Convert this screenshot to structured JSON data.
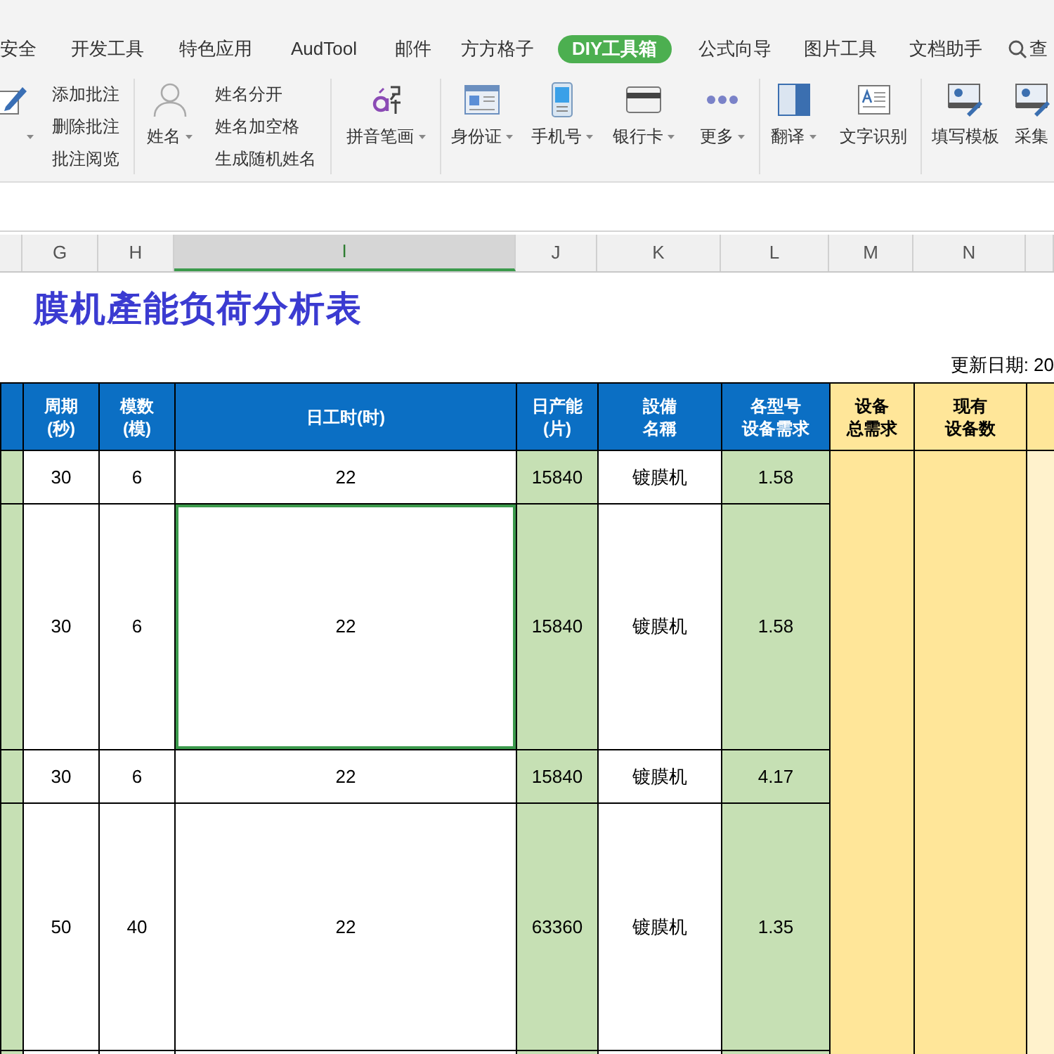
{
  "tabs": [
    {
      "label": "安全",
      "selected": false
    },
    {
      "label": "开发工具",
      "selected": false
    },
    {
      "label": "特色应用",
      "selected": false
    },
    {
      "label": "AudTool",
      "selected": false
    },
    {
      "label": "邮件",
      "selected": false
    },
    {
      "label": "方方格子",
      "selected": false
    },
    {
      "label": "DIY工具箱",
      "selected": true
    },
    {
      "label": "公式向导",
      "selected": false
    },
    {
      "label": "图片工具",
      "selected": false
    },
    {
      "label": "文档助手",
      "selected": false
    }
  ],
  "search": {
    "label": "查"
  },
  "ribbon": [
    {
      "kind": "large",
      "dropdown": true
    },
    {
      "kind": "small",
      "items": [
        "添加批注",
        "删除批注",
        "批注阅览"
      ]
    },
    {
      "kind": "separator"
    },
    {
      "kind": "large",
      "label": "姓名",
      "dropdown": true
    },
    {
      "kind": "small",
      "items": [
        "姓名分开",
        "姓名加空格",
        "生成随机姓名"
      ]
    },
    {
      "kind": "separator"
    },
    {
      "kind": "large",
      "label": "拼音笔画",
      "dropdown": true
    },
    {
      "kind": "separator"
    },
    {
      "kind": "large",
      "label": "身份证",
      "dropdown": true
    },
    {
      "kind": "large",
      "label": "手机号",
      "dropdown": true
    },
    {
      "kind": "large",
      "label": "银行卡",
      "dropdown": true
    },
    {
      "kind": "large",
      "label": "更多",
      "dropdown": true
    },
    {
      "kind": "separator"
    },
    {
      "kind": "large",
      "label": "翻译",
      "dropdown": true
    },
    {
      "kind": "large",
      "label": "文字识别",
      "dropdown": false
    },
    {
      "kind": "separator"
    },
    {
      "kind": "large",
      "label": "填写模板",
      "dropdown": false
    },
    {
      "kind": "large",
      "label": "采集",
      "dropdown": false
    }
  ],
  "column_headers": [
    {
      "selected": false
    },
    {
      "label": "G",
      "selected": false
    },
    {
      "label": "H",
      "selected": false
    },
    {
      "label": "I",
      "selected": true
    },
    {
      "label": "J",
      "selected": false
    },
    {
      "label": "K",
      "selected": false
    },
    {
      "label": "L",
      "selected": false
    },
    {
      "label": "M",
      "selected": false
    },
    {
      "label": "N",
      "selected": false
    },
    {
      "selected": false
    }
  ],
  "title": "膜机產能负荷分析表",
  "update_date": "更新日期: 20",
  "table": {
    "columns": [
      "周期(秒)",
      "模数(模)",
      "日工时(时)",
      "日产能(片)",
      "設備名稱",
      "各型号设备需求",
      "设备总需求",
      "现有设备数"
    ],
    "rows": [
      {
        "cells": [
          {
            "text": "30",
            "selected": false
          },
          {
            "text": "6",
            "selected": false
          },
          {
            "text": "22",
            "selected": false
          },
          {
            "text": "15840",
            "selected": false
          },
          {
            "text": "镀膜机",
            "selected": false
          },
          {
            "text": "1.58",
            "selected": false
          }
        ]
      },
      {
        "cells": [
          {
            "text": "30",
            "selected": false
          },
          {
            "text": "6",
            "selected": false
          },
          {
            "text": "22",
            "selected": true
          },
          {
            "text": "15840",
            "selected": false
          },
          {
            "text": "镀膜机",
            "selected": false
          },
          {
            "text": "1.58",
            "selected": false
          }
        ]
      },
      {
        "cells": [
          {
            "text": "30",
            "selected": false
          },
          {
            "text": "6",
            "selected": false
          },
          {
            "text": "22",
            "selected": false
          },
          {
            "text": "15840",
            "selected": false
          },
          {
            "text": "镀膜机",
            "selected": false
          },
          {
            "text": "4.17",
            "selected": false
          }
        ]
      },
      {
        "cells": [
          {
            "text": "50",
            "selected": false
          },
          {
            "text": "40",
            "selected": false
          },
          {
            "text": "22",
            "selected": false
          },
          {
            "text": "63360",
            "selected": false
          },
          {
            "text": "镀膜机",
            "selected": false
          },
          {
            "text": "1.35",
            "selected": false
          }
        ]
      }
    ]
  }
}
